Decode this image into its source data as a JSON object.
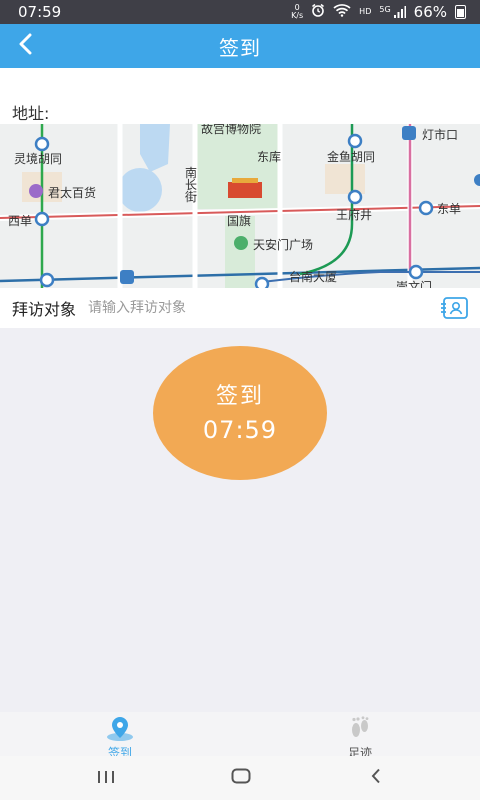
{
  "status_bar": {
    "time": "07:59",
    "net_speed_top": "0",
    "net_speed_unit": "K/s",
    "hd_label": "HD",
    "network_label": "5G",
    "battery": "66%"
  },
  "header": {
    "title": "签到",
    "back_icon": "chevron-left-icon"
  },
  "address": {
    "label": "地址:"
  },
  "map": {
    "labels": [
      "故宫博物院",
      "灯市口",
      "灵境胡同",
      "东库",
      "金鱼胡同",
      "南",
      "长",
      "街",
      "君太百货",
      "西单",
      "王府井",
      "东单",
      "国旗",
      "天安门广场",
      "台南大厦",
      "崇文门"
    ]
  },
  "visit": {
    "label": "拜访对象",
    "placeholder": "请输入拜访对象",
    "icon": "contact-card-icon"
  },
  "checkin_button": {
    "label": "签到",
    "time": "07:59",
    "color": "#f2a954"
  },
  "tabs": [
    {
      "label": "签到",
      "icon": "location-pin-icon",
      "active": true
    },
    {
      "label": "足迹",
      "icon": "footprint-icon",
      "active": false
    }
  ],
  "system_nav": {
    "recents_icon": "recents-icon",
    "home_icon": "home-icon",
    "back_icon": "back-icon"
  },
  "colors": {
    "accent": "#3ea6e8",
    "status_bar": "#3f3f47",
    "checkin": "#f2a954"
  }
}
